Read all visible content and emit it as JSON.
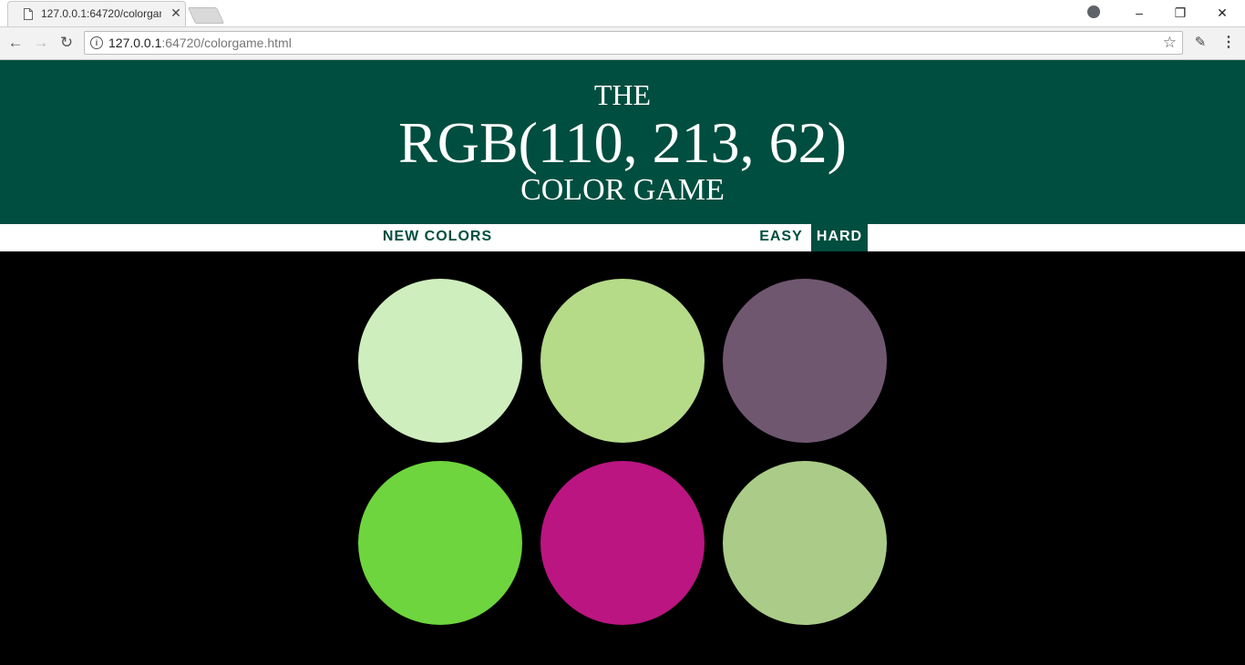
{
  "browser": {
    "tab_title": "127.0.0.1:64720/colorgam",
    "url_host": "127.0.0.1",
    "url_rest": ":64720/colorgame.html"
  },
  "header": {
    "line1": "THE",
    "rgb": "RGB(110, 213, 62)",
    "line3": "COLOR GAME"
  },
  "controls": {
    "new_colors": "NEW COLORS",
    "easy": "EASY",
    "hard": "HARD",
    "selected_mode": "HARD"
  },
  "squares": [
    {
      "color": "#cfeebd"
    },
    {
      "color": "#b5da88"
    },
    {
      "color": "#705770"
    },
    {
      "color": "#6ed53e"
    },
    {
      "color": "#bb1581"
    },
    {
      "color": "#abcc88"
    }
  ]
}
